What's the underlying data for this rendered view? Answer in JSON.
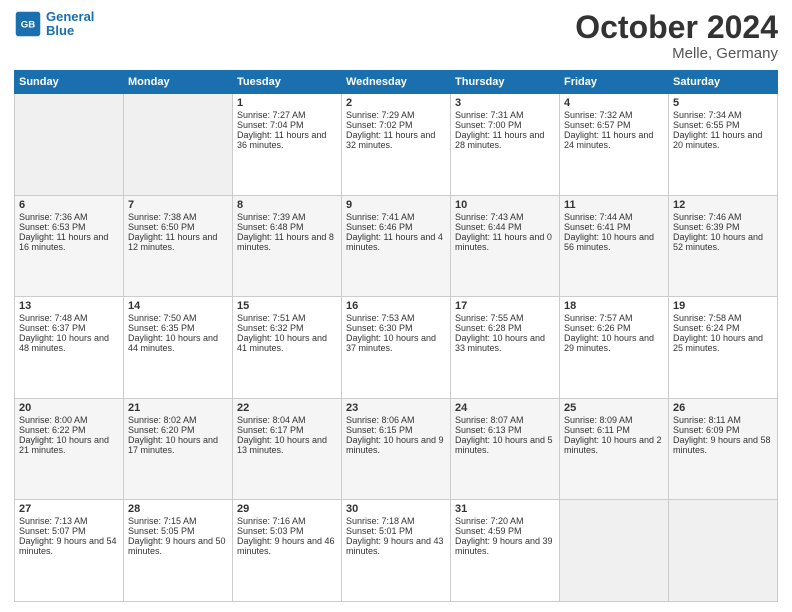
{
  "header": {
    "logo_line1": "General",
    "logo_line2": "Blue",
    "title": "October 2024",
    "subtitle": "Melle, Germany"
  },
  "weekdays": [
    "Sunday",
    "Monday",
    "Tuesday",
    "Wednesday",
    "Thursday",
    "Friday",
    "Saturday"
  ],
  "weeks": [
    [
      {
        "day": "",
        "sunrise": "",
        "sunset": "",
        "daylight": ""
      },
      {
        "day": "",
        "sunrise": "",
        "sunset": "",
        "daylight": ""
      },
      {
        "day": "1",
        "sunrise": "Sunrise: 7:27 AM",
        "sunset": "Sunset: 7:04 PM",
        "daylight": "Daylight: 11 hours and 36 minutes."
      },
      {
        "day": "2",
        "sunrise": "Sunrise: 7:29 AM",
        "sunset": "Sunset: 7:02 PM",
        "daylight": "Daylight: 11 hours and 32 minutes."
      },
      {
        "day": "3",
        "sunrise": "Sunrise: 7:31 AM",
        "sunset": "Sunset: 7:00 PM",
        "daylight": "Daylight: 11 hours and 28 minutes."
      },
      {
        "day": "4",
        "sunrise": "Sunrise: 7:32 AM",
        "sunset": "Sunset: 6:57 PM",
        "daylight": "Daylight: 11 hours and 24 minutes."
      },
      {
        "day": "5",
        "sunrise": "Sunrise: 7:34 AM",
        "sunset": "Sunset: 6:55 PM",
        "daylight": "Daylight: 11 hours and 20 minutes."
      }
    ],
    [
      {
        "day": "6",
        "sunrise": "Sunrise: 7:36 AM",
        "sunset": "Sunset: 6:53 PM",
        "daylight": "Daylight: 11 hours and 16 minutes."
      },
      {
        "day": "7",
        "sunrise": "Sunrise: 7:38 AM",
        "sunset": "Sunset: 6:50 PM",
        "daylight": "Daylight: 11 hours and 12 minutes."
      },
      {
        "day": "8",
        "sunrise": "Sunrise: 7:39 AM",
        "sunset": "Sunset: 6:48 PM",
        "daylight": "Daylight: 11 hours and 8 minutes."
      },
      {
        "day": "9",
        "sunrise": "Sunrise: 7:41 AM",
        "sunset": "Sunset: 6:46 PM",
        "daylight": "Daylight: 11 hours and 4 minutes."
      },
      {
        "day": "10",
        "sunrise": "Sunrise: 7:43 AM",
        "sunset": "Sunset: 6:44 PM",
        "daylight": "Daylight: 11 hours and 0 minutes."
      },
      {
        "day": "11",
        "sunrise": "Sunrise: 7:44 AM",
        "sunset": "Sunset: 6:41 PM",
        "daylight": "Daylight: 10 hours and 56 minutes."
      },
      {
        "day": "12",
        "sunrise": "Sunrise: 7:46 AM",
        "sunset": "Sunset: 6:39 PM",
        "daylight": "Daylight: 10 hours and 52 minutes."
      }
    ],
    [
      {
        "day": "13",
        "sunrise": "Sunrise: 7:48 AM",
        "sunset": "Sunset: 6:37 PM",
        "daylight": "Daylight: 10 hours and 48 minutes."
      },
      {
        "day": "14",
        "sunrise": "Sunrise: 7:50 AM",
        "sunset": "Sunset: 6:35 PM",
        "daylight": "Daylight: 10 hours and 44 minutes."
      },
      {
        "day": "15",
        "sunrise": "Sunrise: 7:51 AM",
        "sunset": "Sunset: 6:32 PM",
        "daylight": "Daylight: 10 hours and 41 minutes."
      },
      {
        "day": "16",
        "sunrise": "Sunrise: 7:53 AM",
        "sunset": "Sunset: 6:30 PM",
        "daylight": "Daylight: 10 hours and 37 minutes."
      },
      {
        "day": "17",
        "sunrise": "Sunrise: 7:55 AM",
        "sunset": "Sunset: 6:28 PM",
        "daylight": "Daylight: 10 hours and 33 minutes."
      },
      {
        "day": "18",
        "sunrise": "Sunrise: 7:57 AM",
        "sunset": "Sunset: 6:26 PM",
        "daylight": "Daylight: 10 hours and 29 minutes."
      },
      {
        "day": "19",
        "sunrise": "Sunrise: 7:58 AM",
        "sunset": "Sunset: 6:24 PM",
        "daylight": "Daylight: 10 hours and 25 minutes."
      }
    ],
    [
      {
        "day": "20",
        "sunrise": "Sunrise: 8:00 AM",
        "sunset": "Sunset: 6:22 PM",
        "daylight": "Daylight: 10 hours and 21 minutes."
      },
      {
        "day": "21",
        "sunrise": "Sunrise: 8:02 AM",
        "sunset": "Sunset: 6:20 PM",
        "daylight": "Daylight: 10 hours and 17 minutes."
      },
      {
        "day": "22",
        "sunrise": "Sunrise: 8:04 AM",
        "sunset": "Sunset: 6:17 PM",
        "daylight": "Daylight: 10 hours and 13 minutes."
      },
      {
        "day": "23",
        "sunrise": "Sunrise: 8:06 AM",
        "sunset": "Sunset: 6:15 PM",
        "daylight": "Daylight: 10 hours and 9 minutes."
      },
      {
        "day": "24",
        "sunrise": "Sunrise: 8:07 AM",
        "sunset": "Sunset: 6:13 PM",
        "daylight": "Daylight: 10 hours and 5 minutes."
      },
      {
        "day": "25",
        "sunrise": "Sunrise: 8:09 AM",
        "sunset": "Sunset: 6:11 PM",
        "daylight": "Daylight: 10 hours and 2 minutes."
      },
      {
        "day": "26",
        "sunrise": "Sunrise: 8:11 AM",
        "sunset": "Sunset: 6:09 PM",
        "daylight": "Daylight: 9 hours and 58 minutes."
      }
    ],
    [
      {
        "day": "27",
        "sunrise": "Sunrise: 7:13 AM",
        "sunset": "Sunset: 5:07 PM",
        "daylight": "Daylight: 9 hours and 54 minutes."
      },
      {
        "day": "28",
        "sunrise": "Sunrise: 7:15 AM",
        "sunset": "Sunset: 5:05 PM",
        "daylight": "Daylight: 9 hours and 50 minutes."
      },
      {
        "day": "29",
        "sunrise": "Sunrise: 7:16 AM",
        "sunset": "Sunset: 5:03 PM",
        "daylight": "Daylight: 9 hours and 46 minutes."
      },
      {
        "day": "30",
        "sunrise": "Sunrise: 7:18 AM",
        "sunset": "Sunset: 5:01 PM",
        "daylight": "Daylight: 9 hours and 43 minutes."
      },
      {
        "day": "31",
        "sunrise": "Sunrise: 7:20 AM",
        "sunset": "Sunset: 4:59 PM",
        "daylight": "Daylight: 9 hours and 39 minutes."
      },
      {
        "day": "",
        "sunrise": "",
        "sunset": "",
        "daylight": ""
      },
      {
        "day": "",
        "sunrise": "",
        "sunset": "",
        "daylight": ""
      }
    ]
  ]
}
